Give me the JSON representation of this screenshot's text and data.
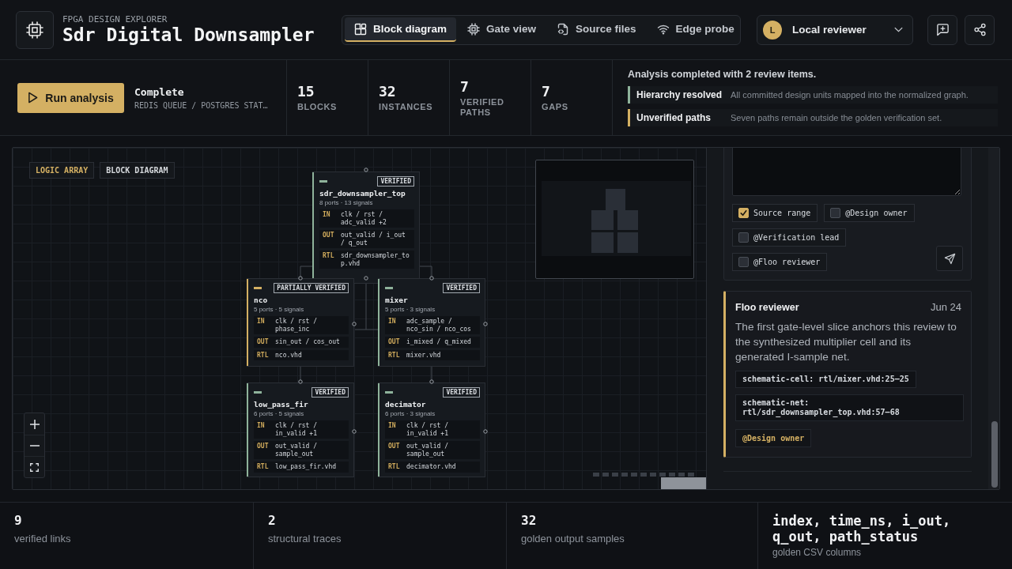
{
  "header": {
    "eyebrow": "FPGA DESIGN EXPLORER",
    "title": "Sdr Digital Downsampler"
  },
  "tabs": [
    {
      "label": "Block diagram",
      "selected": true
    },
    {
      "label": "Gate view",
      "selected": false
    },
    {
      "label": "Source files",
      "selected": false
    },
    {
      "label": "Edge probe",
      "selected": false
    }
  ],
  "reviewer": {
    "initial": "L",
    "name": "Local reviewer"
  },
  "run": {
    "button": "Run analysis",
    "status": "Complete",
    "detail": "REDIS QUEUE / POSTGRES STAT…"
  },
  "stats": [
    {
      "value": "15",
      "label": "BLOCKS"
    },
    {
      "value": "32",
      "label": "INSTANCES"
    },
    {
      "value": "7",
      "label": "VERIFIED PATHS"
    },
    {
      "value": "7",
      "label": "GAPS"
    }
  ],
  "summary": {
    "title": "Analysis completed with 2 review items.",
    "items": [
      {
        "label": "Hierarchy resolved",
        "text": "All committed design units mapped into the normalized graph.",
        "color": "#8fb39b"
      },
      {
        "label": "Unverified paths",
        "text": "Seven paths remain outside the golden verification set.",
        "color": "#d4b063"
      }
    ]
  },
  "canvas": {
    "tags": [
      {
        "label": "LOGIC ARRAY",
        "selected": true
      },
      {
        "label": "BLOCK DIAGRAM",
        "selected": false
      }
    ],
    "nodes": [
      {
        "name": "sdr_downsampler_top",
        "meta": "8 ports · 13 signals",
        "status": "VERIFIED",
        "color": "#8fb39b",
        "rows": [
          {
            "dir": "IN",
            "value": "clk / rst / adc_valid +2"
          },
          {
            "dir": "OUT",
            "value": "out_valid / i_out / q_out"
          },
          {
            "dir": "RTL",
            "value": "sdr_downsampler_top.vhd"
          }
        ]
      },
      {
        "name": "nco",
        "meta": "5 ports · 5 signals",
        "status": "PARTIALLY VERIFIED",
        "color": "#d4b063",
        "rows": [
          {
            "dir": "IN",
            "value": "clk / rst / phase_inc"
          },
          {
            "dir": "OUT",
            "value": "sin_out / cos_out"
          },
          {
            "dir": "RTL",
            "value": "nco.vhd"
          }
        ]
      },
      {
        "name": "mixer",
        "meta": "5 ports · 3 signals",
        "status": "VERIFIED",
        "color": "#8fb39b",
        "rows": [
          {
            "dir": "IN",
            "value": "adc_sample / nco_sin / nco_cos"
          },
          {
            "dir": "OUT",
            "value": "i_mixed / q_mixed"
          },
          {
            "dir": "RTL",
            "value": "mixer.vhd"
          }
        ]
      },
      {
        "name": "low_pass_fir",
        "meta": "6 ports · 5 signals",
        "status": "VERIFIED",
        "color": "#8fb39b",
        "rows": [
          {
            "dir": "IN",
            "value": "clk / rst / in_valid +1"
          },
          {
            "dir": "OUT",
            "value": "out_valid / sample_out"
          },
          {
            "dir": "RTL",
            "value": "low_pass_fir.vhd"
          }
        ]
      },
      {
        "name": "decimator",
        "meta": "6 ports · 3 signals",
        "status": "VERIFIED",
        "color": "#8fb39b",
        "rows": [
          {
            "dir": "IN",
            "value": "clk / rst / in_valid +1"
          },
          {
            "dir": "OUT",
            "value": "out_valid / sample_out"
          },
          {
            "dir": "RTL",
            "value": "decimator.vhd"
          }
        ]
      }
    ]
  },
  "comment_form": {
    "mentions": [
      {
        "label": "Source range",
        "checked": true
      },
      {
        "label": "@Design owner",
        "checked": false
      },
      {
        "label": "@Verification lead",
        "checked": false
      },
      {
        "label": "@Floo reviewer",
        "checked": false
      }
    ]
  },
  "comments": [
    {
      "author": "Floo reviewer",
      "date": "Jun 24",
      "body": "The first gate-level slice anchors this review to the synthesized multiplier cell and its generated I-sample net.",
      "refs": [
        "schematic-cell: rtl/mixer.vhd:25–25",
        "schematic-net: rtl/sdr_downsampler_top.vhd:57–68"
      ],
      "mention": "@Design owner"
    }
  ],
  "footer": [
    {
      "kind": "count",
      "value": "9",
      "label": "verified links"
    },
    {
      "kind": "count",
      "value": "2",
      "label": "structural traces"
    },
    {
      "kind": "count",
      "value": "32",
      "label": "golden output samples"
    },
    {
      "kind": "columns",
      "value": "index, time_ns, i_out, q_out, path_status",
      "label": "golden CSV columns"
    }
  ]
}
